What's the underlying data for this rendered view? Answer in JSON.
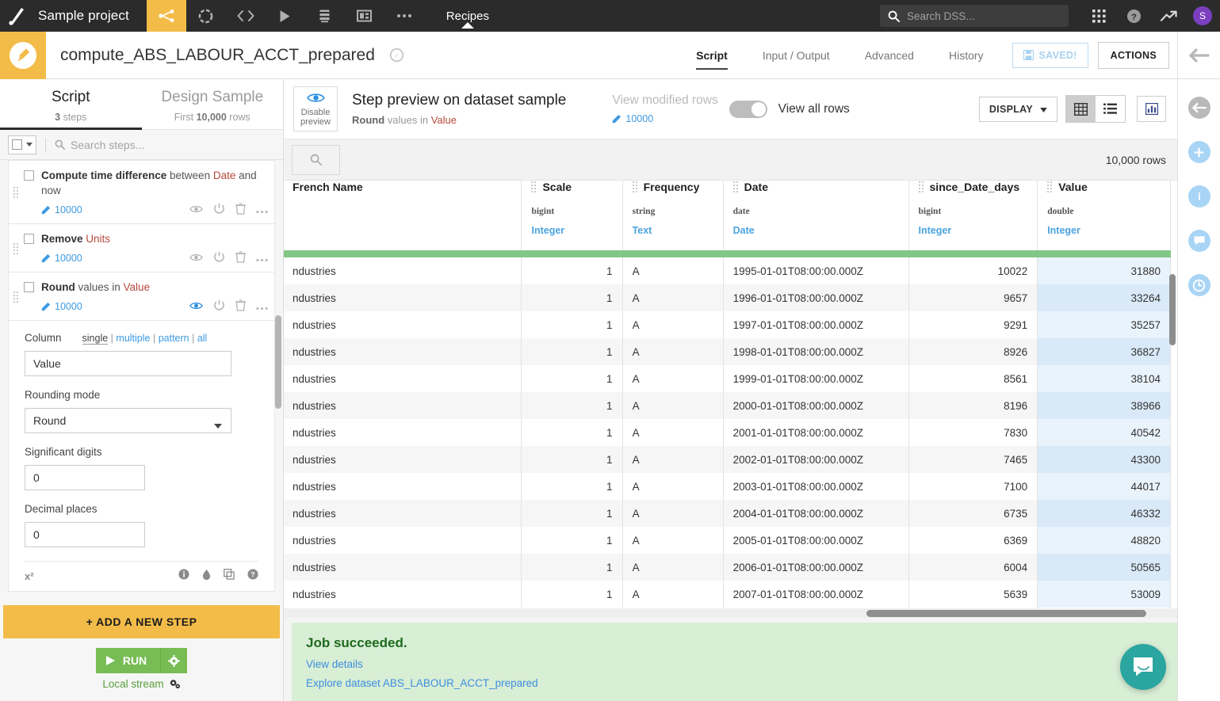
{
  "topnav": {
    "project_name": "Sample project",
    "icons": [
      "flow-icon",
      "lab-icon",
      "code-icon",
      "jobs-icon",
      "datasets-icon",
      "dashboard-icon",
      "more-icon"
    ],
    "section_label": "Recipes",
    "search_placeholder": "Search DSS...",
    "apps_icon": "apps-grid-icon",
    "help_icon": "help-circle-icon",
    "activity_icon": "trending-up-icon",
    "avatar_initial": "S"
  },
  "recipe_header": {
    "title": "compute_ABS_LABOUR_ACCT_prepared",
    "tabs": [
      {
        "label": "Script",
        "active": true
      },
      {
        "label": "Input / Output",
        "active": false
      },
      {
        "label": "Advanced",
        "active": false
      },
      {
        "label": "History",
        "active": false
      }
    ],
    "saved_label": "SAVED!",
    "actions_label": "ACTIONS"
  },
  "left_panel": {
    "tabs": [
      {
        "title": "Script",
        "sub_pre": "",
        "sub_strong": "3",
        "sub_post": " steps",
        "active": true
      },
      {
        "title": "Design Sample",
        "sub_pre": "First ",
        "sub_strong": "10,000",
        "sub_post": " rows",
        "active": false
      }
    ],
    "search_placeholder": "Search steps...",
    "steps": [
      {
        "verb": "Compute time difference",
        "mid": " between ",
        "column": "Date",
        "tail": " and now",
        "count": "10000",
        "preview_on": false
      },
      {
        "verb": "Remove",
        "mid": " ",
        "column": "Units",
        "tail": "",
        "count": "10000",
        "preview_on": false
      },
      {
        "verb": "Round",
        "mid": " values in ",
        "column": "Value",
        "tail": "",
        "count": "10000",
        "preview_on": true
      }
    ],
    "options": {
      "column_label": "Column",
      "modes": [
        "single",
        "multiple",
        "pattern",
        "all"
      ],
      "selected_mode": "single",
      "column_value": "Value",
      "rounding_mode_label": "Rounding mode",
      "rounding_mode_value": "Round",
      "significant_digits_label": "Significant digits",
      "significant_digits_value": "0",
      "decimal_places_label": "Decimal places",
      "decimal_places_value": "0",
      "formula_icon": "x-squared-icon",
      "footer_icons": [
        "info-icon",
        "droplet-icon",
        "copy-icon",
        "help-icon"
      ]
    },
    "add_step_label": "+ ADD A NEW STEP",
    "run_label": "RUN",
    "engine_label": "Local stream"
  },
  "preview_bar": {
    "disable_preview_label": "Disable preview",
    "title": "Step preview on dataset sample",
    "subtitle_strong": "Round",
    "subtitle_mid": " values in ",
    "subtitle_column": "Value",
    "view_modified_label": "View modified rows",
    "view_modified_count": "10000",
    "view_all_label": "View all rows",
    "toggle_on": true,
    "display_label": "DISPLAY",
    "view_modes": [
      "grid-view-icon",
      "list-view-icon"
    ],
    "active_view_mode": "grid-view-icon",
    "chart_icon": "bar-chart-icon"
  },
  "table": {
    "row_count_label": "10,000 rows",
    "columns": [
      {
        "name": "French Name",
        "storage": "",
        "meaning": "",
        "align": "left",
        "truncated": true
      },
      {
        "name": "Scale",
        "storage": "bigint",
        "meaning": "Integer",
        "align": "right"
      },
      {
        "name": "Frequency",
        "storage": "string",
        "meaning": "Text",
        "align": "left"
      },
      {
        "name": "Date",
        "storage": "date",
        "meaning": "Date",
        "align": "left"
      },
      {
        "name": "since_Date_days",
        "storage": "bigint",
        "meaning": "Integer",
        "align": "right"
      },
      {
        "name": "Value",
        "storage": "double",
        "meaning": "Integer",
        "align": "right",
        "highlight": true
      }
    ],
    "rows": [
      [
        "ndustries",
        "1",
        "A",
        "1995-01-01T08:00:00.000Z",
        "10022",
        "31880"
      ],
      [
        "ndustries",
        "1",
        "A",
        "1996-01-01T08:00:00.000Z",
        "9657",
        "33264"
      ],
      [
        "ndustries",
        "1",
        "A",
        "1997-01-01T08:00:00.000Z",
        "9291",
        "35257"
      ],
      [
        "ndustries",
        "1",
        "A",
        "1998-01-01T08:00:00.000Z",
        "8926",
        "36827"
      ],
      [
        "ndustries",
        "1",
        "A",
        "1999-01-01T08:00:00.000Z",
        "8561",
        "38104"
      ],
      [
        "ndustries",
        "1",
        "A",
        "2000-01-01T08:00:00.000Z",
        "8196",
        "38966"
      ],
      [
        "ndustries",
        "1",
        "A",
        "2001-01-01T08:00:00.000Z",
        "7830",
        "40542"
      ],
      [
        "ndustries",
        "1",
        "A",
        "2002-01-01T08:00:00.000Z",
        "7465",
        "43300"
      ],
      [
        "ndustries",
        "1",
        "A",
        "2003-01-01T08:00:00.000Z",
        "7100",
        "44017"
      ],
      [
        "ndustries",
        "1",
        "A",
        "2004-01-01T08:00:00.000Z",
        "6735",
        "46332"
      ],
      [
        "ndustries",
        "1",
        "A",
        "2005-01-01T08:00:00.000Z",
        "6369",
        "48820"
      ],
      [
        "ndustries",
        "1",
        "A",
        "2006-01-01T08:00:00.000Z",
        "6004",
        "50565"
      ],
      [
        "ndustries",
        "1",
        "A",
        "2007-01-01T08:00:00.000Z",
        "5639",
        "53009"
      ]
    ]
  },
  "job_panel": {
    "status": "Job succeeded.",
    "details_link": "View details",
    "explore_link": "Explore dataset ABS_LABOUR_ACCT_prepared"
  },
  "rail": {
    "icons": [
      "back-arrow-icon",
      "plus-circle-icon",
      "info-circle-icon",
      "comment-circle-icon",
      "clock-circle-icon"
    ]
  },
  "colors": {
    "accent_yellow": "#f3bc48",
    "green_run": "#77bc54",
    "green_bar": "#82c785",
    "link_blue": "#3e9ae2",
    "column_red": "#b5483c",
    "value_highlight": "#e9f3fc",
    "intercom_teal": "#2ba5a0"
  }
}
